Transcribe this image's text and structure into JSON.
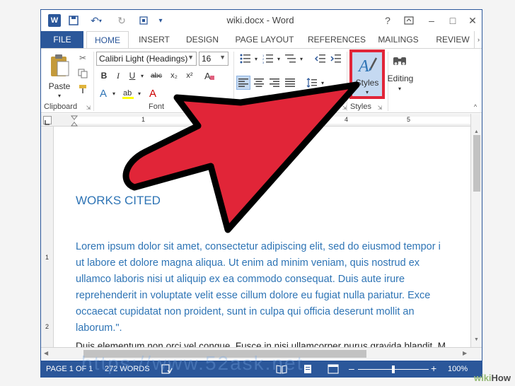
{
  "window": {
    "title": "wiki.docx - Word",
    "help": "?",
    "minimize": "–",
    "restore": "□",
    "close": "✕",
    "app_icon_letter": "W"
  },
  "tabs": {
    "file": "FILE",
    "items": [
      "HOME",
      "INSERT",
      "DESIGN",
      "PAGE LAYOUT",
      "REFERENCES",
      "MAILINGS",
      "REVIEW"
    ],
    "active": "HOME"
  },
  "ribbon": {
    "clipboard": {
      "paste_label": "Paste",
      "group_label": "Clipboard"
    },
    "font": {
      "font_name": "Calibri Light (Headings)",
      "font_size": "16",
      "bold": "B",
      "italic": "I",
      "underline": "U",
      "strike": "abc",
      "subscript": "x₂",
      "superscript": "x²",
      "text_effects": "A",
      "font_color": "A",
      "group_label": "Font"
    },
    "styles": {
      "label": "Styles",
      "group_label": "Styles"
    },
    "editing": {
      "label": "Editing"
    }
  },
  "ruler": {
    "marks": [
      "1",
      "4",
      "5"
    ],
    "vmarks": [
      "1",
      "2"
    ]
  },
  "document": {
    "heading": "WORKS CITED",
    "lines": [
      "Lorem ipsum dolor sit amet, consectetur adipiscing elit, sed do eiusmod tempor i",
      "ut labore et dolore magna aliqua. Ut enim ad minim veniam, quis nostrud ex",
      "ullamco laboris nisi ut aliquip ex ea commodo consequat. Duis aute irure",
      "reprehenderit in voluptate velit esse cillum dolore eu fugiat nulla pariatur. Exce",
      "occaecat cupidatat non proident, sunt in culpa qui officia deserunt mollit an",
      "laborum.\"."
    ],
    "next_line": " Duis elementum non orci vel congue. Fusce in nisi ullamcorper purus gravida blandit. M"
  },
  "statusbar": {
    "page": "PAGE 1 OF 1",
    "words": "272 WORDS",
    "zoom": "100%",
    "zoom_minus": "–",
    "zoom_plus": "+",
    "zoom_level": 0.5
  },
  "overlay": {
    "watermark": "https://www.52ask.net",
    "brand_wiki": "wiki",
    "brand_how": "How",
    "arrow_color": "#e12538",
    "highlight_color": "#e12538"
  }
}
